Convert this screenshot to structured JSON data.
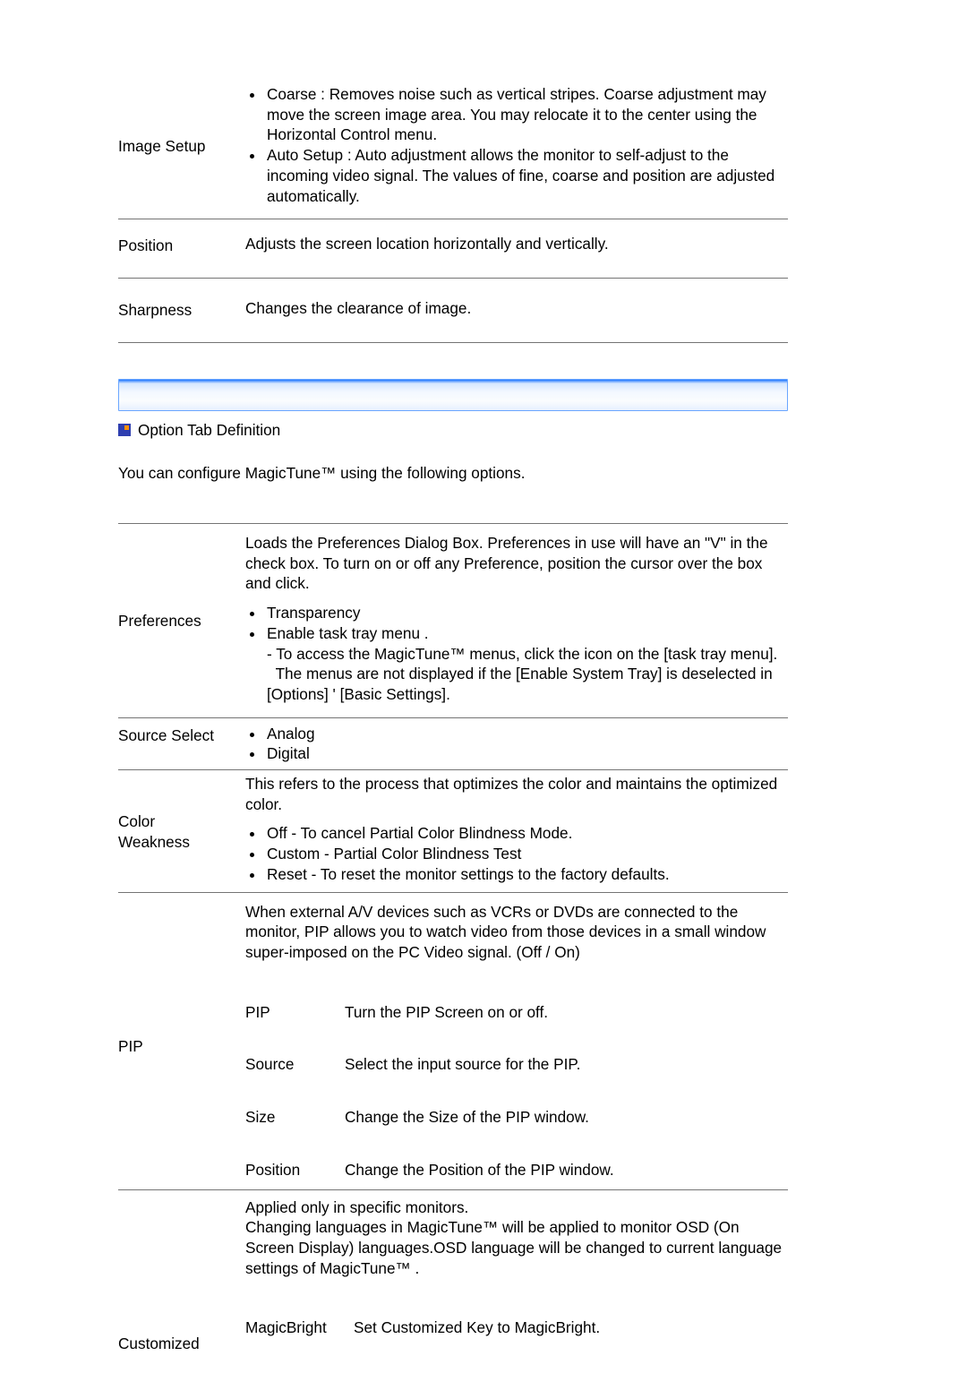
{
  "top": {
    "imageSetup": {
      "label": "Image Setup",
      "coarse": "Coarse : Removes noise such as vertical stripes. Coarse adjustment may move the screen image area. You may relocate it to the center using the Horizontal Control menu.",
      "autoSetup": "Auto Setup : Auto adjustment allows the monitor to self-adjust to the incoming video signal. The values of fine, coarse and position are adjusted automatically."
    },
    "position": {
      "label": "Position",
      "desc": "Adjusts the screen location horizontally and vertically."
    },
    "sharpness": {
      "label": "Sharpness",
      "desc": "Changes the clearance of image."
    }
  },
  "section": {
    "title": "Option Tab Definition",
    "intro": "You can configure MagicTune™ using the following options."
  },
  "options": {
    "preferences": {
      "label": "Preferences",
      "lead": "Loads the Preferences Dialog Box. Preferences in use will have an \"V\" in the check box. To turn on or off any Preference, position the cursor over the box and click.",
      "transparency": "Transparency",
      "enableTray": "Enable task tray menu .",
      "trayNote1": "- To access the MagicTune™ menus, click the icon on the [task tray menu].",
      "trayNote2": "  The menus are not displayed if the [Enable System Tray] is deselected in [Options] ' [Basic Settings]."
    },
    "sourceSelect": {
      "label": "Source Select",
      "analog": "Analog",
      "digital": "Digital"
    },
    "colorWeakness": {
      "label": "Color Weakness",
      "lead": "This refers to the process that optimizes the color and maintains the optimized color.",
      "off": "Off - To cancel Partial Color Blindness Mode.",
      "custom": "Custom - Partial Color Blindness Test",
      "reset": "Reset - To reset the monitor settings to the factory defaults."
    },
    "pip": {
      "label": "PIP",
      "lead": "When external A/V devices such as VCRs or DVDs are connected to the monitor, PIP allows you to watch video from those devices in a small window super-imposed on the PC Video signal. (Off / On)",
      "rows": [
        {
          "label": "PIP",
          "desc": "Turn the PIP Screen on or off."
        },
        {
          "label": "Source",
          "desc": "Select the input source for the PIP."
        },
        {
          "label": "Size",
          "desc": "Change the Size of the PIP window."
        },
        {
          "label": "Position",
          "desc": "Change the Position of the PIP window."
        }
      ]
    },
    "customized": {
      "label": "Customized",
      "lead": "Applied only in specific monitors.\nChanging languages in MagicTune™ will be applied to monitor OSD (On Screen Display) languages.OSD language will be changed to current language settings of MagicTune™ .",
      "magicBright": {
        "label": "MagicBright",
        "desc": "Set Customized Key to MagicBright."
      }
    }
  }
}
